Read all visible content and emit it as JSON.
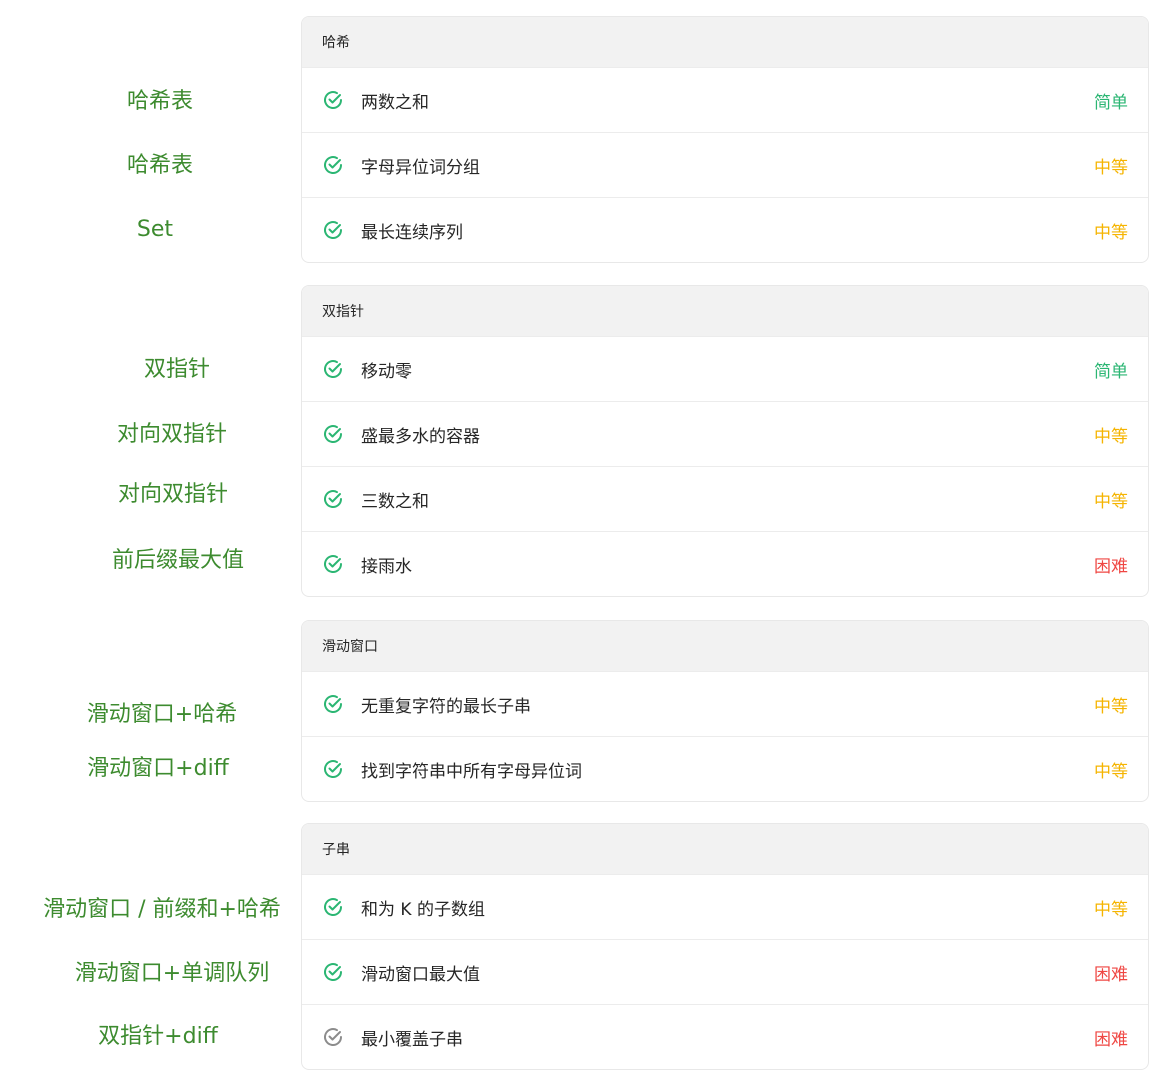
{
  "colors": {
    "note": "#3d8b2f",
    "easy": "#2bb673",
    "medium": "#f5b400",
    "hard": "#ef4743",
    "solved_icon": "#2bb673",
    "attempted_icon": "#8c8c8c"
  },
  "notes": [
    "哈希表",
    "哈希表",
    "Set",
    "双指针",
    "对向双指针",
    "对向双指针",
    "前后缀最大值",
    "滑动窗口+哈希",
    "滑动窗口+diff",
    "滑动窗口 / 前缀和+哈希",
    "滑动窗口+单调队列",
    "双指针+diff"
  ],
  "sections": [
    {
      "header": "哈希",
      "problems": [
        {
          "title": "两数之和",
          "difficulty": "简单",
          "status_icon": "check-circle-icon"
        },
        {
          "title": "字母异位词分组",
          "difficulty": "中等",
          "status_icon": "check-circle-icon"
        },
        {
          "title": "最长连续序列",
          "difficulty": "中等",
          "status_icon": "check-circle-icon"
        }
      ]
    },
    {
      "header": "双指针",
      "problems": [
        {
          "title": "移动零",
          "difficulty": "简单",
          "status_icon": "check-circle-icon"
        },
        {
          "title": "盛最多水的容器",
          "difficulty": "中等",
          "status_icon": "check-circle-icon"
        },
        {
          "title": "三数之和",
          "difficulty": "中等",
          "status_icon": "check-circle-icon"
        },
        {
          "title": "接雨水",
          "difficulty": "困难",
          "status_icon": "check-circle-icon"
        }
      ]
    },
    {
      "header": "滑动窗口",
      "problems": [
        {
          "title": "无重复字符的最长子串",
          "difficulty": "中等",
          "status_icon": "check-circle-icon"
        },
        {
          "title": "找到字符串中所有字母异位词",
          "difficulty": "中等",
          "status_icon": "check-circle-icon"
        }
      ]
    },
    {
      "header": "子串",
      "problems": [
        {
          "title": "和为 K 的子数组",
          "difficulty": "中等",
          "status_icon": "check-circle-icon"
        },
        {
          "title": "滑动窗口最大值",
          "difficulty": "困难",
          "status_icon": "check-circle-icon"
        },
        {
          "title": "最小覆盖子串",
          "difficulty": "困难",
          "status_icon": "attempted-check-circle-icon"
        }
      ]
    }
  ]
}
